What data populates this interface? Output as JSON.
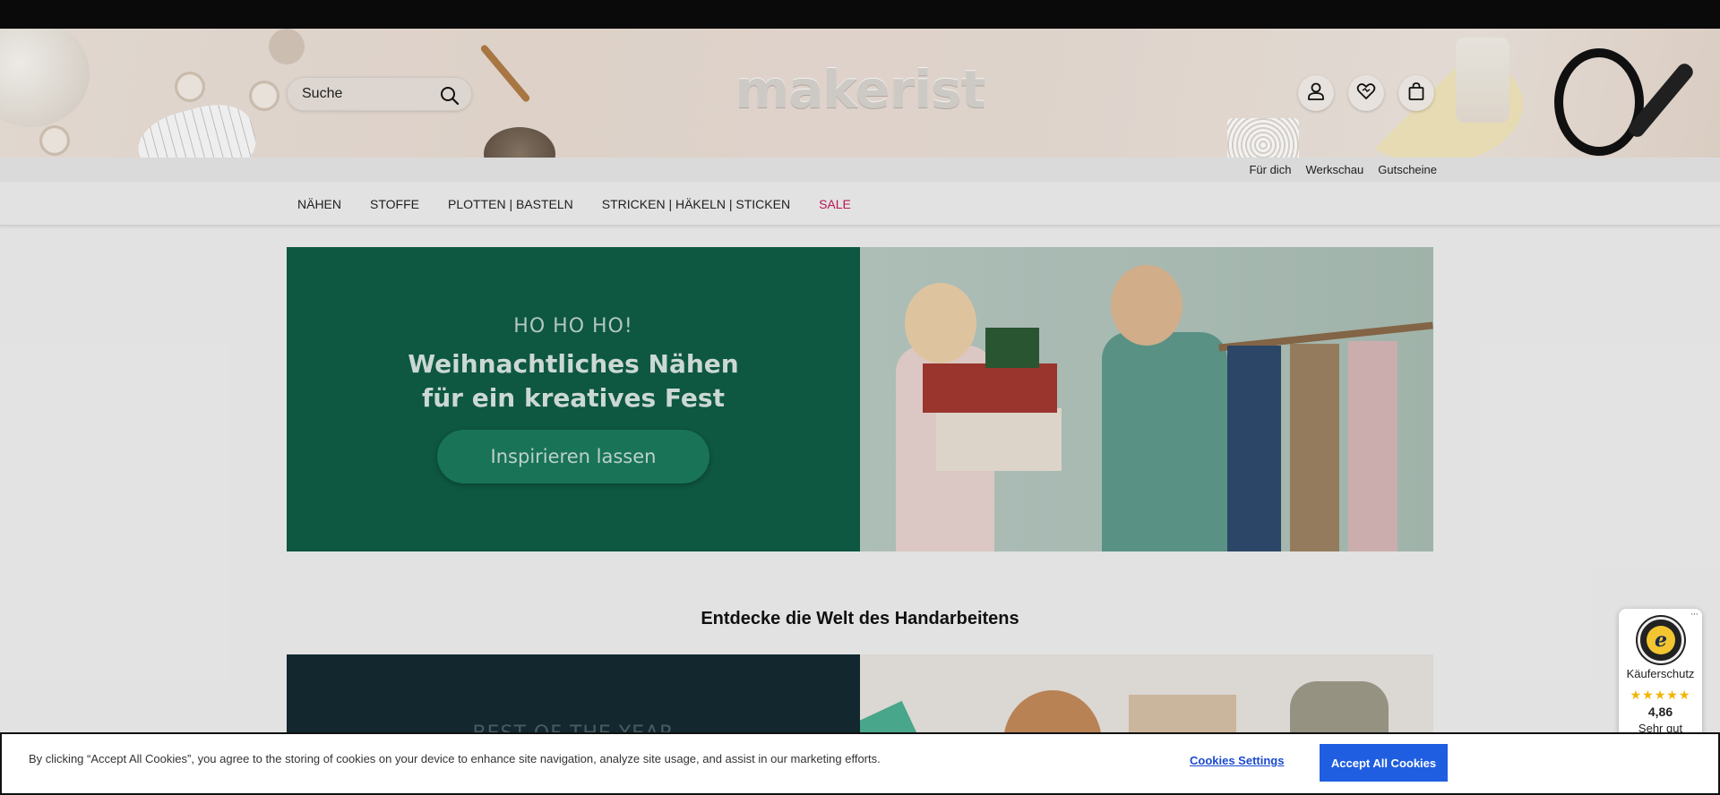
{
  "header": {
    "search_placeholder": "Suche",
    "logo_text": "makerist"
  },
  "service_links": [
    "Für dich",
    "Werkschau",
    "Gutscheine"
  ],
  "nav": {
    "items": [
      "NÄHEN",
      "STOFFE",
      "PLOTTEN | BASTELN",
      "STRICKEN | HÄKELN | STICKEN"
    ],
    "sale": "SALE",
    "sale_color": "#c2185b"
  },
  "hero": {
    "kicker": "HO HO HO!",
    "title_line1": "Weihnachtliches Nähen",
    "title_line2": "für ein kreatives Fest",
    "cta": "Inspirieren lassen",
    "bg_color": "#0f5c45"
  },
  "section": {
    "title": "Entdecke die Welt des Handarbeitens"
  },
  "promo2": {
    "kicker": "BEST OF THE YEAR"
  },
  "trust_badge": {
    "label": "Käuferschutz",
    "stars": "★★★★★",
    "score": "4,86",
    "rating_text": "Sehr gut",
    "more": "···"
  },
  "cookie_banner": {
    "text": "By clicking “Accept All Cookies”, you agree to the storing of cookies on your device to enhance site navigation, analyze site usage, and assist in our marketing efforts.",
    "settings_label": "Cookies Settings",
    "accept_label": "Accept All Cookies",
    "accent_color": "#1f5ee0"
  },
  "icons": [
    "search-icon",
    "account-icon",
    "wishlist-heart-icon",
    "cart-bag-icon",
    "trusted-shops-seal-icon"
  ]
}
